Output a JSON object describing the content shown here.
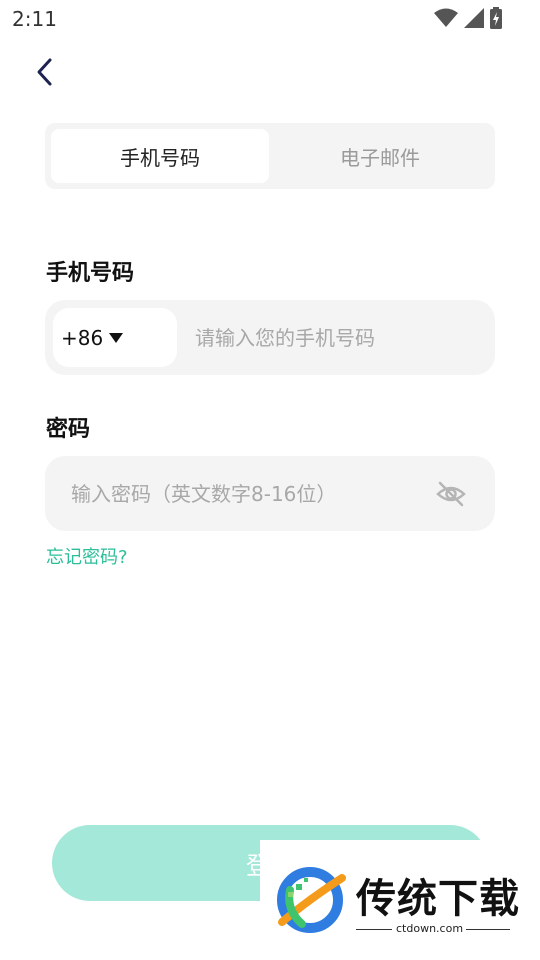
{
  "status_bar": {
    "time": "2:11"
  },
  "tabs": [
    {
      "label": "手机号码",
      "active": true
    },
    {
      "label": "电子邮件",
      "active": false
    }
  ],
  "phone": {
    "label": "手机号码",
    "country_code": "+86",
    "placeholder": "请输入您的手机号码"
  },
  "password": {
    "label": "密码",
    "placeholder": "输入密码（英文数字8-16位）"
  },
  "forgot_label": "忘记密码?",
  "login_label": "登录",
  "watermark": {
    "name": "传统下载",
    "url": "ctdown.com"
  },
  "colors": {
    "accent": "#2bbf9a",
    "button": "#a3e8d8",
    "field_bg": "#f4f4f4"
  }
}
